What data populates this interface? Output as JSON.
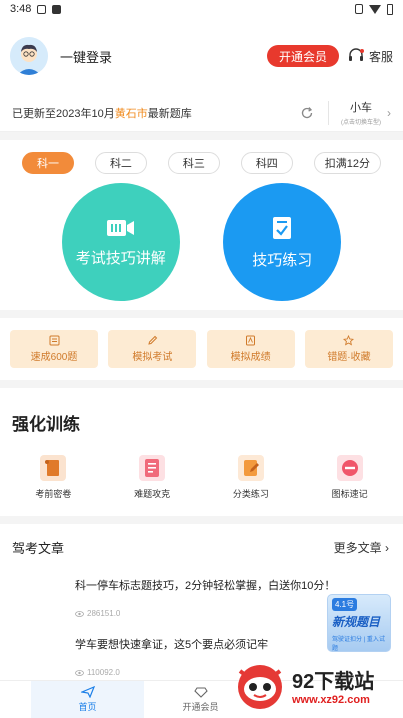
{
  "status": {
    "time": "3:48"
  },
  "user": {
    "login_label": "一键登录",
    "vip_button": "开通会员",
    "service_label": "客服"
  },
  "update": {
    "prefix": "已更新至2023年10月",
    "city": "黄石市",
    "suffix": "最新题库",
    "car_type": "小车",
    "car_hint": "(点击切换车型)"
  },
  "subjects": [
    "科一",
    "科二",
    "科三",
    "科四",
    "扣满12分"
  ],
  "big_buttons": {
    "left": "考试技巧讲解",
    "right": "技巧练习"
  },
  "tools": [
    "速成600题",
    "模拟考试",
    "模拟成绩",
    "错题·收藏"
  ],
  "training": {
    "title": "强化训练",
    "items": [
      "考前密卷",
      "难题攻克",
      "分类练习",
      "图标速记"
    ]
  },
  "articles": {
    "title": "驾考文章",
    "more": "更多文章",
    "list": [
      {
        "title": "科一停车标志题技巧，2分钟轻松掌握，白送你10分！",
        "views": "286151.0"
      },
      {
        "title": "学车要想快速拿证，这5个要点必须记牢",
        "views": "110092.0"
      }
    ]
  },
  "promo": {
    "tag": "4.1号",
    "main": "新规题目",
    "sub": "驾驶证扣分 | 重入试题"
  },
  "tabs": {
    "home": "首页",
    "vip": "开通会员"
  },
  "watermark": {
    "title": "92下载站",
    "url": "www.xz92.com"
  },
  "colors": {
    "accent_red": "#e8392d",
    "accent_orange": "#f28b3a",
    "teal": "#3ed0bd",
    "blue": "#1b9af2"
  }
}
